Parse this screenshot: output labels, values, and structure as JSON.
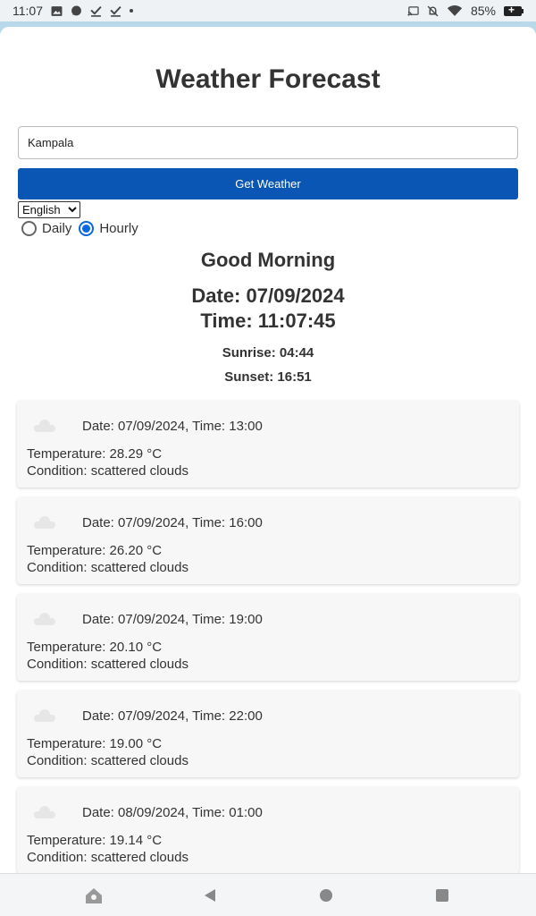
{
  "status_bar": {
    "time": "11:07",
    "battery": "85%",
    "icons": [
      "image-icon",
      "chat-icon",
      "check-icon",
      "check-icon",
      "dot-icon",
      "cast-icon",
      "mute-icon",
      "wifi-icon",
      "battery-icon"
    ]
  },
  "app": {
    "title": "Weather Forecast",
    "search": {
      "value": "Kampala"
    },
    "button_label": "Get Weather",
    "language": {
      "selected": "English"
    },
    "view_mode": {
      "options": [
        {
          "label": "Daily",
          "checked": false
        },
        {
          "label": "Hourly",
          "checked": true
        }
      ]
    },
    "greeting": "Good Morning",
    "date_line": "Date: 07/09/2024",
    "time_line": "Time: 11:07:45",
    "sunrise": "Sunrise: 04:44",
    "sunset": "Sunset: 16:51"
  },
  "forecast": [
    {
      "icon": "cloud-icon",
      "heading": "Date: 07/09/2024, Time: 13:00",
      "temperature": "Temperature: 28.29 °C",
      "condition": "Condition: scattered clouds"
    },
    {
      "icon": "cloud-icon",
      "heading": "Date: 07/09/2024, Time: 16:00",
      "temperature": "Temperature: 26.20 °C",
      "condition": "Condition: scattered clouds"
    },
    {
      "icon": "cloud-icon",
      "heading": "Date: 07/09/2024, Time: 19:00",
      "temperature": "Temperature: 20.10 °C",
      "condition": "Condition: scattered clouds"
    },
    {
      "icon": "cloud-icon",
      "heading": "Date: 07/09/2024, Time: 22:00",
      "temperature": "Temperature: 19.00 °C",
      "condition": "Condition: scattered clouds"
    },
    {
      "icon": "cloud-icon",
      "heading": "Date: 08/09/2024, Time: 01:00",
      "temperature": "Temperature: 19.14 °C",
      "condition": "Condition: scattered clouds"
    }
  ],
  "nav_bar": {
    "icons": [
      "home-icon",
      "back-icon",
      "circle-home-icon",
      "recents-icon"
    ]
  },
  "colors": {
    "accent": "#0a56b4",
    "card_bg": "#f7f7f7",
    "radio_checked": "#0a67e0"
  }
}
